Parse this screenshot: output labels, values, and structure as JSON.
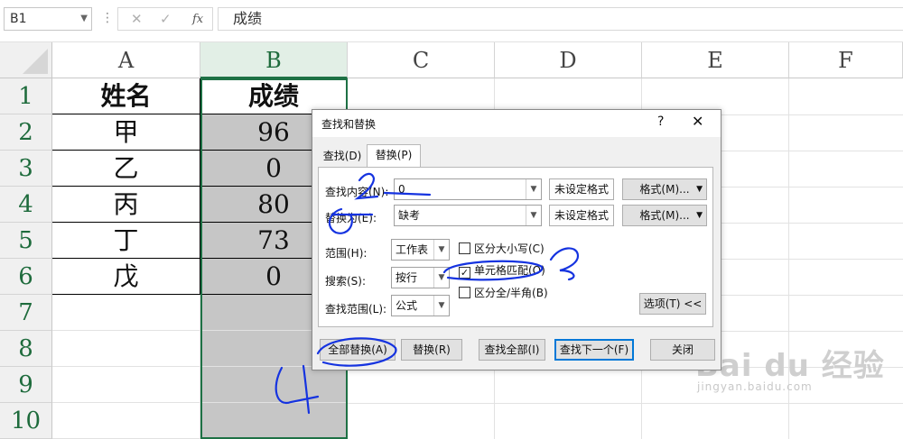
{
  "formula_bar": {
    "name_box": "B1",
    "dots": "⋮",
    "cancel_glyph": "✕",
    "enter_glyph": "✓",
    "fx_label": "fx",
    "content": "成绩"
  },
  "columns": [
    "A",
    "B",
    "C",
    "D",
    "E",
    "F"
  ],
  "rows": [
    "1",
    "2",
    "3",
    "4",
    "5",
    "6",
    "7",
    "8",
    "9",
    "10"
  ],
  "sheet": {
    "header": {
      "a": "姓名",
      "b": "成绩"
    },
    "data": [
      {
        "a": "甲",
        "b": "96"
      },
      {
        "a": "乙",
        "b": "0"
      },
      {
        "a": "丙",
        "b": "80"
      },
      {
        "a": "丁",
        "b": "73"
      },
      {
        "a": "戊",
        "b": "0"
      }
    ]
  },
  "dialog": {
    "title": "查找和替换",
    "help": "?",
    "close": "✕",
    "tabs": [
      "查找(D)",
      "替换(P)"
    ],
    "find_label": "查找内容(N):",
    "find_value": "0",
    "replace_label": "替换为(E):",
    "replace_value": "缺考",
    "no_format_1": "未设定格式",
    "no_format_2": "未设定格式",
    "format_btn_1": "格式(M)...",
    "format_btn_2": "格式(M)...",
    "within_label": "范围(H):",
    "within_value": "工作表",
    "search_label": "搜索(S):",
    "search_value": "按行",
    "lookin_label": "查找范围(L):",
    "lookin_value": "公式",
    "match_case": "区分大小写(C)",
    "match_cell": "单元格匹配(O)",
    "match_cell_checked": true,
    "match_width": "区分全/半角(B)",
    "options_btn": "选项(T) <<",
    "replace_all": "全部替换(A)",
    "replace": "替换(R)",
    "find_all": "查找全部(I)",
    "find_next": "查找下一个(F)",
    "close_btn": "关闭"
  },
  "watermark": {
    "brand": "Bai du 经验",
    "url": "jingyan.baidu.com"
  },
  "colors": {
    "accent": "#1e7145",
    "annotation": "#1533e0",
    "selected_fill": "#c6c6c6"
  },
  "annotations": [
    "1",
    "2",
    "3",
    "4"
  ]
}
